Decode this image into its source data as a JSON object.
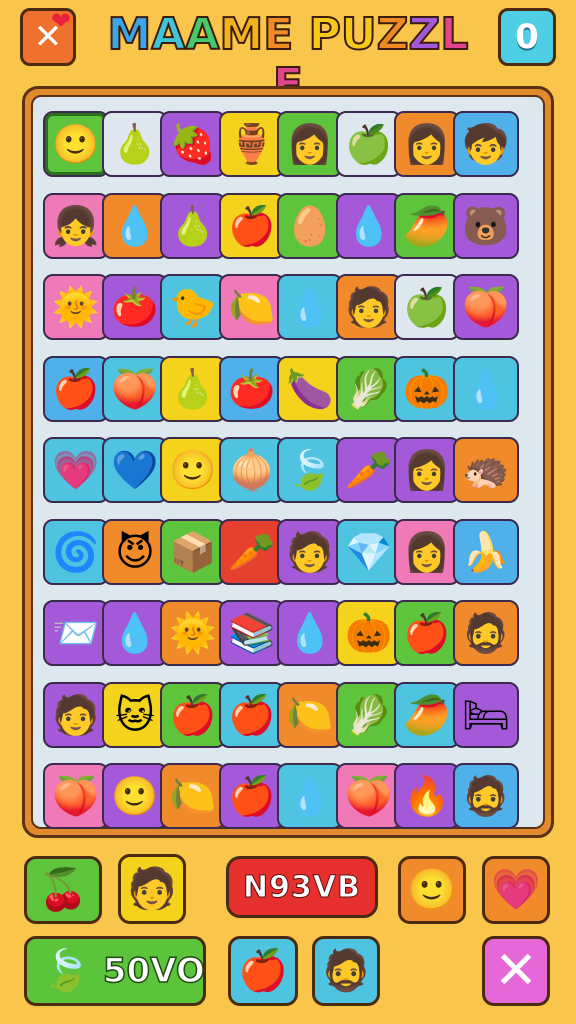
{
  "header": {
    "title_letters": [
      {
        "ch": "M",
        "color": "#3aa6e8"
      },
      {
        "ch": "A",
        "color": "#3fc4d8"
      },
      {
        "ch": "A",
        "color": "#45c96a"
      },
      {
        "ch": "M",
        "color": "#f2b21c"
      },
      {
        "ch": "E",
        "color": "#f08a24"
      },
      {
        "ch": " ",
        "color": "#000000"
      },
      {
        "ch": "P",
        "color": "#f5c81c"
      },
      {
        "ch": "U",
        "color": "#f5c81c"
      },
      {
        "ch": "Z",
        "color": "#ee8a24"
      },
      {
        "ch": "Z",
        "color": "#a45ad8"
      },
      {
        "ch": "L",
        "color": "#e2468a"
      },
      {
        "ch": "E",
        "color": "#e2468a"
      }
    ],
    "close_icon": "✕",
    "heart_icon": "❤",
    "score_value": "0"
  },
  "board": {
    "rows": [
      [
        [
          "#5dc43c",
          "🙂"
        ],
        [
          "#dfe7ee",
          "🍐"
        ],
        [
          "#a45ad8",
          "🍓"
        ],
        [
          "#f5d21c",
          "🏺"
        ],
        [
          "#5dc43c",
          "👩"
        ],
        [
          "#dfe7ee",
          "🍏"
        ],
        [
          "#f08a2a",
          "👩"
        ],
        [
          "#4fb0ea",
          "🧒"
        ]
      ],
      [
        [
          "#f07ab8",
          "👧"
        ],
        [
          "#f08a2a",
          "💧"
        ],
        [
          "#a45ad8",
          "🍐"
        ],
        [
          "#f5d21c",
          "🍎"
        ],
        [
          "#5dc43c",
          "🥚"
        ],
        [
          "#a45ad8",
          "💧"
        ],
        [
          "#5dc43c",
          "🥭"
        ],
        [
          "#a45ad8",
          "🐻"
        ]
      ],
      [
        [
          "#f07ab8",
          "🌞"
        ],
        [
          "#a45ad8",
          "🍅"
        ],
        [
          "#4fc4e0",
          "🐤"
        ],
        [
          "#f07ab8",
          "🍋"
        ],
        [
          "#4fc4e0",
          "💧"
        ],
        [
          "#f08a2a",
          "🧑"
        ],
        [
          "#dfe7ee",
          "🍏"
        ],
        [
          "#a45ad8",
          "🍑"
        ]
      ],
      [
        [
          "#4fb0ea",
          "🍎"
        ],
        [
          "#4fc4e0",
          "🍑"
        ],
        [
          "#f5d21c",
          "🍐"
        ],
        [
          "#4fb0ea",
          "🍅"
        ],
        [
          "#f5d21c",
          "🍆"
        ],
        [
          "#5dc43c",
          "🥬"
        ],
        [
          "#4fc4e0",
          "🎃"
        ],
        [
          "#4fc4e0",
          "💧"
        ]
      ],
      [
        [
          "#4fc4e0",
          "💗"
        ],
        [
          "#4fc4e0",
          "💙"
        ],
        [
          "#f5d21c",
          "🙂"
        ],
        [
          "#4fc4e0",
          "🧅"
        ],
        [
          "#4fc4e0",
          "🍃"
        ],
        [
          "#a45ad8",
          "🥕"
        ],
        [
          "#a45ad8",
          "👩"
        ],
        [
          "#f08a2a",
          "🦔"
        ]
      ],
      [
        [
          "#4fc4e0",
          "🌀"
        ],
        [
          "#f08a2a",
          "😈"
        ],
        [
          "#5dc43c",
          "📦"
        ],
        [
          "#e6402e",
          "🥕"
        ],
        [
          "#a45ad8",
          "🧑"
        ],
        [
          "#4fc4e0",
          "💎"
        ],
        [
          "#f07ab8",
          "👩"
        ],
        [
          "#4fb0ea",
          "🍌"
        ]
      ],
      [
        [
          "#a45ad8",
          "📨"
        ],
        [
          "#a45ad8",
          "💧"
        ],
        [
          "#f08a2a",
          "🌞"
        ],
        [
          "#a45ad8",
          "📚"
        ],
        [
          "#a45ad8",
          "💧"
        ],
        [
          "#f5d21c",
          "🎃"
        ],
        [
          "#5dc43c",
          "🍎"
        ],
        [
          "#f08a2a",
          "🧔"
        ]
      ],
      [
        [
          "#a45ad8",
          "🧑"
        ],
        [
          "#f5d21c",
          "🐱"
        ],
        [
          "#5dc43c",
          "🍎"
        ],
        [
          "#4fc4e0",
          "🍎"
        ],
        [
          "#f08a2a",
          "🍋"
        ],
        [
          "#5dc43c",
          "🥬"
        ],
        [
          "#4fc4e0",
          "🥭"
        ],
        [
          "#a45ad8",
          "🛏"
        ]
      ],
      [
        [
          "#f07ab8",
          "🍑"
        ],
        [
          "#a45ad8",
          "🙂"
        ],
        [
          "#f08a2a",
          "🍋"
        ],
        [
          "#a45ad8",
          "🍎"
        ],
        [
          "#4fc4e0",
          "💧"
        ],
        [
          "#f07ab8",
          "🍑"
        ],
        [
          "#a45ad8",
          "🔥"
        ],
        [
          "#4fb0ea",
          "🧔"
        ]
      ]
    ],
    "selected": [
      0,
      0
    ]
  },
  "hud": {
    "fruit_pair": {
      "icon": "🍒",
      "bg": "#5dc43c"
    },
    "character": {
      "icon": "🧑",
      "bg": "#f5d21c"
    },
    "moves_label": "N93VB",
    "face": {
      "icon": "🙂",
      "bg": "#f08a2a"
    },
    "heart": {
      "icon": "💗",
      "bg": "#f08a2a"
    },
    "score_leaf_icon": "🍃",
    "score_label": "50VO",
    "apple": {
      "icon": "🍎",
      "bg": "#4fc4e0"
    },
    "character2": {
      "icon": "🧔",
      "bg": "#4fc4e0"
    },
    "cancel_icon": "✕"
  }
}
